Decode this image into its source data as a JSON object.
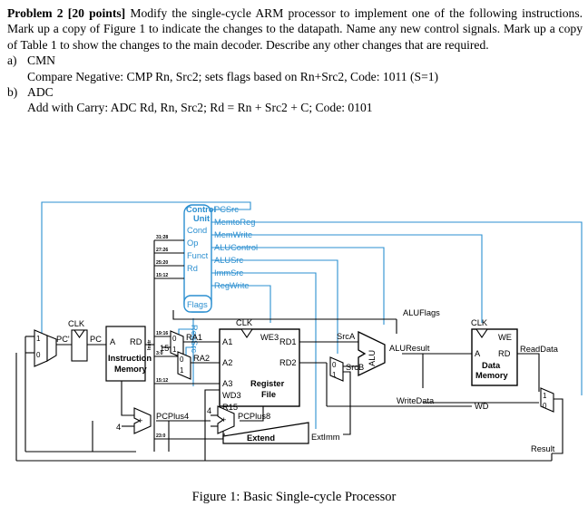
{
  "problem": {
    "heading": "Problem 2 [20 points]",
    "body": "Modify the single-cycle ARM processor to implement one of the following instructions. Mark up a copy of Figure 1 to indicate the changes to the datapath. Name any new control signals. Mark up a copy of Table 1 to show the changes to the main decoder. Describe any other changes that are required.",
    "items": [
      {
        "marker": "a)",
        "title": "CMN",
        "detail": "Compare Negative: CMP Rn, Src2; sets flags based on Rn+Src2, Code: 1011 (S=1)"
      },
      {
        "marker": "b)",
        "title": "ADC",
        "detail": "Add with Carry: ADC Rd, Rn, Src2; Rd = Rn + Src2 + C; Code: 0101"
      }
    ]
  },
  "figure": {
    "caption": "Figure 1: Basic Single-cycle Processor",
    "colors": {
      "control_blue": "#2b8fd0",
      "wire_black": "#000000",
      "background": "#ffffff"
    },
    "control_unit": {
      "name_line1": "Control",
      "name_line2": "Unit",
      "inputs": [
        "Cond",
        "Op",
        "Funct",
        "Rd"
      ],
      "flags_port": "Flags",
      "outputs": [
        "PCSrc",
        "MemtoReg",
        "MemWrite",
        "ALUControl",
        "ALUSrc",
        "ImmSrc",
        "RegWrite"
      ]
    },
    "bitfields": {
      "cond": "31:28",
      "op": "27:26",
      "funct": "25:20",
      "rd": "15:12",
      "ra1": "19:16",
      "ra2": "3:0",
      "a3": "15:12",
      "imm": "23:0",
      "const15": "15"
    },
    "blocks": {
      "instruction_memory": {
        "line1": "Instruction",
        "line2": "Memory",
        "port_a": "A",
        "port_rd": "RD"
      },
      "register_file": {
        "line1": "Register",
        "line2": "File",
        "ports": [
          "A1",
          "A2",
          "A3",
          "WD3",
          "R15",
          "WE3",
          "RD1",
          "RD2"
        ]
      },
      "data_memory": {
        "line1": "Data",
        "line2": "Memory",
        "ports": [
          "A",
          "RD",
          "WD",
          "WE"
        ]
      },
      "alu": "ALU",
      "extend": "Extend"
    },
    "wire_labels": {
      "clk": "CLK",
      "pc_next": "PC'",
      "pc": "PC",
      "instr": "Instr",
      "regsrc": "RegSrc",
      "ra1": "RA1",
      "ra2": "RA2",
      "srca": "SrcA",
      "srcb": "SrcB",
      "alu_result": "ALUResult",
      "alu_flags": "ALUFlags",
      "write_data": "WriteData",
      "read_data": "ReadData",
      "result": "Result",
      "pcplus4": "PCPlus4",
      "pcplus8": "PCPlus8",
      "extimm": "ExtImm",
      "const4": "4",
      "plus": "+"
    },
    "mux_selectors": [
      "0",
      "1"
    ]
  }
}
